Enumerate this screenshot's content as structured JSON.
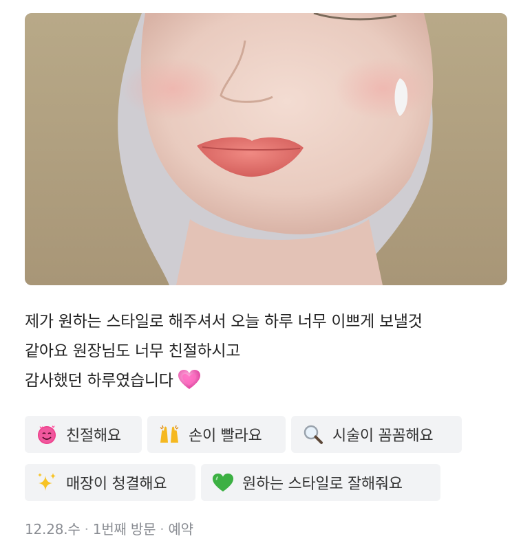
{
  "review": {
    "lines": [
      "제가 원하는 스타일로 해주셔서 오늘 하루 너무 이쁘게 보낼것",
      "같아요 원장님도 너무 친절하시고",
      "감사했던 하루였습니다"
    ]
  },
  "tags": [
    {
      "label": "친절해요",
      "icon": "smiling-face-with-hearts-icon"
    },
    {
      "label": "손이 빨라요",
      "icon": "raising-hands-icon"
    },
    {
      "label": "시술이 꼼꼼해요",
      "icon": "magnifying-glass-icon"
    },
    {
      "label": "매장이 청결해요",
      "icon": "sparkles-icon"
    },
    {
      "label": "원하는 스타일로 잘해줘요",
      "icon": "green-heart-icon"
    }
  ],
  "meta": {
    "date": "12.28.수",
    "visit": "1번째 방문",
    "type": "예약"
  },
  "colors": {
    "tag_bg": "#f2f3f5",
    "meta_text": "#8a8d93"
  }
}
